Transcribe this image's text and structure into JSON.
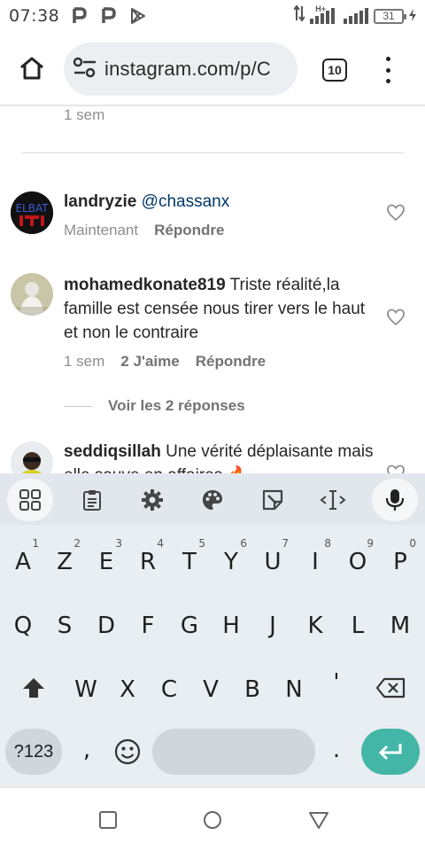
{
  "status_bar": {
    "time": "07:38",
    "network_type": "H+",
    "battery_level": "31"
  },
  "browser": {
    "url": "instagram.com/p/C",
    "tab_count": "10"
  },
  "content": {
    "previous_comment_time": "1 sem",
    "comments": [
      {
        "username": "landryzie",
        "text": "@chassanx",
        "time": "Maintenant",
        "likes": "",
        "reply_label": "Répondre",
        "avatar_text": "ELBAT"
      },
      {
        "username": "mohamedkonate819",
        "text": "Triste réalité,la famille est censée nous tirer vers le haut et non le contraire",
        "time": "1 sem",
        "likes": "2 J'aime",
        "reply_label": "Répondre"
      },
      {
        "username": "seddiqsillah",
        "text": "Une vérité déplaisante mais elle sauve en affaires 🔥",
        "time": "",
        "likes": "",
        "reply_label": ""
      }
    ],
    "view_replies": "Voir les 2 réponses"
  },
  "keyboard": {
    "row1": [
      "A",
      "Z",
      "E",
      "R",
      "T",
      "Y",
      "U",
      "I",
      "O",
      "P"
    ],
    "row1_numbers": [
      "1",
      "2",
      "3",
      "4",
      "5",
      "6",
      "7",
      "8",
      "9",
      "0"
    ],
    "row2": [
      "Q",
      "S",
      "D",
      "F",
      "G",
      "H",
      "J",
      "K",
      "L",
      "M"
    ],
    "row3": [
      "W",
      "X",
      "C",
      "V",
      "B",
      "N",
      "'"
    ],
    "symbols_label": "?123",
    "comma": ",",
    "period": "."
  },
  "colors": {
    "enter_key": "#44b6a8",
    "meta_text": "#8e8e8e"
  }
}
